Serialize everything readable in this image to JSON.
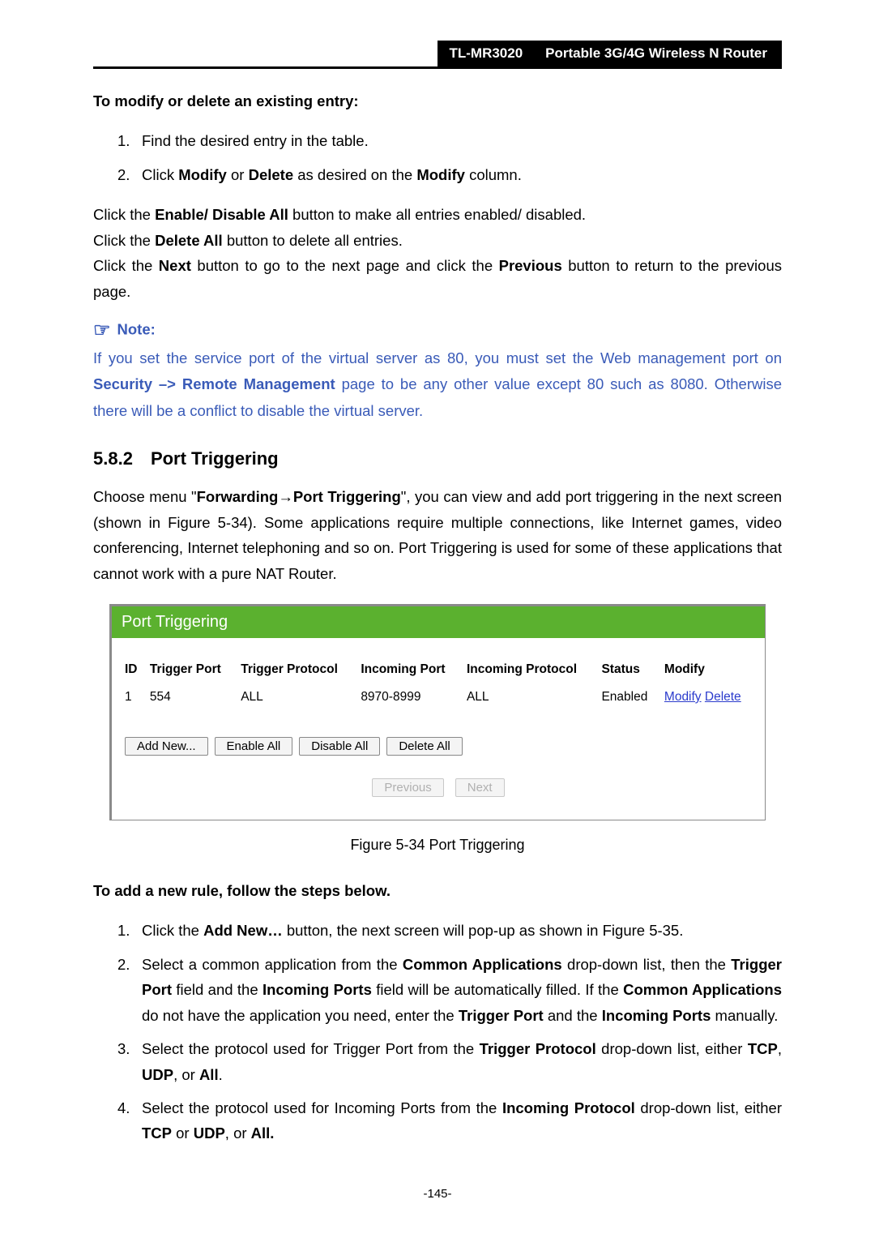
{
  "header": {
    "model": "TL-MR3020",
    "product": "Portable 3G/4G Wireless N Router"
  },
  "intro": {
    "modify_heading": "To modify or delete an existing entry:",
    "step1": "Find the desired entry in the table.",
    "step2_prefix": "Click ",
    "step2_modify": "Modify",
    "step2_mid": " or ",
    "step2_delete": "Delete",
    "step2_mid2": " as desired on the ",
    "step2_col": "Modify",
    "step2_suffix": " column.",
    "p1a": "Click the ",
    "p1b": "Enable/ Disable All",
    "p1c": " button to make all entries enabled/ disabled.",
    "p2a": "Click the ",
    "p2b": "Delete All",
    "p2c": " button to delete all entries.",
    "p3a": "Click the ",
    "p3b": "Next",
    "p3c": " button to go to the next page and click the ",
    "p3d": "Previous",
    "p3e": " button to return to the previous page."
  },
  "note": {
    "label": "Note:",
    "body_a": "If you set the service port of the virtual server as 80, you must set the Web management port on ",
    "body_b": "Security –> Remote Management",
    "body_c": " page to be any other value except 80 such as 8080. Otherwise there will be a conflict to disable the virtual server."
  },
  "section": {
    "num": "5.8.2",
    "title": "Port Triggering",
    "para_a": "Choose menu \"",
    "para_b": "Forwarding→Port Triggering",
    "para_c": "\", you can view and add port triggering in the next screen (shown in Figure 5-34). Some applications require multiple connections, like Internet games, video conferencing, Internet telephoning and so on. Port Triggering is used for some of these applications that cannot work with a pure NAT Router."
  },
  "figure": {
    "banner": "Port Triggering",
    "headers": {
      "id": "ID",
      "trigger_port": "Trigger Port",
      "trigger_protocol": "Trigger Protocol",
      "incoming_port": "Incoming Port",
      "incoming_protocol": "Incoming Protocol",
      "status": "Status",
      "modify": "Modify"
    },
    "row": {
      "id": "1",
      "trigger_port": "554",
      "trigger_protocol": "ALL",
      "incoming_port": "8970-8999",
      "incoming_protocol": "ALL",
      "status": "Enabled",
      "modify_link": "Modify",
      "delete_link": "Delete"
    },
    "buttons": {
      "add": "Add New...",
      "enable_all": "Enable All",
      "disable_all": "Disable All",
      "delete_all": "Delete All",
      "previous": "Previous",
      "next": "Next"
    },
    "caption": "Figure 5-34   Port Triggering"
  },
  "addrule": {
    "heading": "To add a new rule, follow the steps below.",
    "s1a": "Click the ",
    "s1b": "Add New…",
    "s1c": " button, the next screen will pop-up as shown in Figure 5-35.",
    "s2a": "Select a common application from the ",
    "s2b": "Common Applications",
    "s2c": " drop-down list, then the ",
    "s2d": "Trigger Port",
    "s2e": " field and the ",
    "s2f": "Incoming Ports",
    "s2g": " field will be automatically filled. If the ",
    "s2h": "Common Applications",
    "s2i": " do not have the application you need, enter the ",
    "s2j": "Trigger Port",
    "s2k": " and the ",
    "s2l": "Incoming Ports",
    "s2m": " manually.",
    "s3a": "Select the protocol used for Trigger Port from the ",
    "s3b": "Trigger Protocol",
    "s3c": " drop-down list, either ",
    "s3d": "TCP",
    "s3e": ", ",
    "s3f": "UDP",
    "s3g": ", or ",
    "s3h": "All",
    "s3i": ".",
    "s4a": "Select the protocol used for Incoming Ports from the ",
    "s4b": "Incoming Protocol",
    "s4c": " drop-down list, either ",
    "s4d": "TCP",
    "s4e": " or ",
    "s4f": "UDP",
    "s4g": ", or ",
    "s4h": "All.",
    "num1": "1.",
    "num2": "2.",
    "num3": "3.",
    "num4": "4."
  },
  "pagenum": "-145-"
}
